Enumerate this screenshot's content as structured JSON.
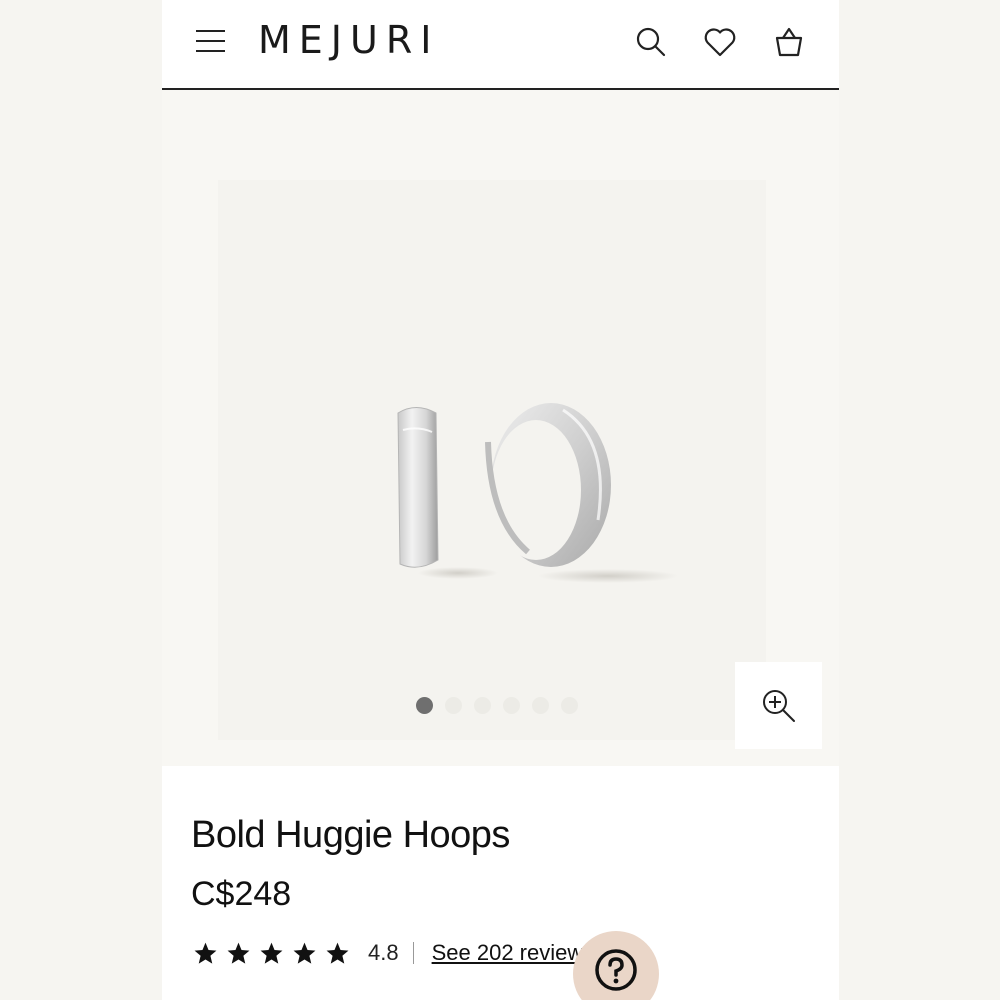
{
  "header": {
    "brand": "MEJURI",
    "icons": [
      "menu-icon",
      "search-icon",
      "heart-icon",
      "bag-icon"
    ]
  },
  "gallery": {
    "image_count": 6,
    "active_index": 0,
    "zoom_icon": "zoom-in-icon"
  },
  "product": {
    "title": "Bold Huggie Hoops",
    "price": "C$248",
    "rating_value": "4.8",
    "star_count": 5,
    "reviews_link": "See 202 reviews"
  },
  "help": {
    "icon": "question-icon",
    "color": "#ead6c8"
  },
  "colors": {
    "page_bg": "#f6f5f1",
    "hero_bg": "#f4f3ef",
    "accent_help": "#ead6c8",
    "text": "#111111"
  }
}
